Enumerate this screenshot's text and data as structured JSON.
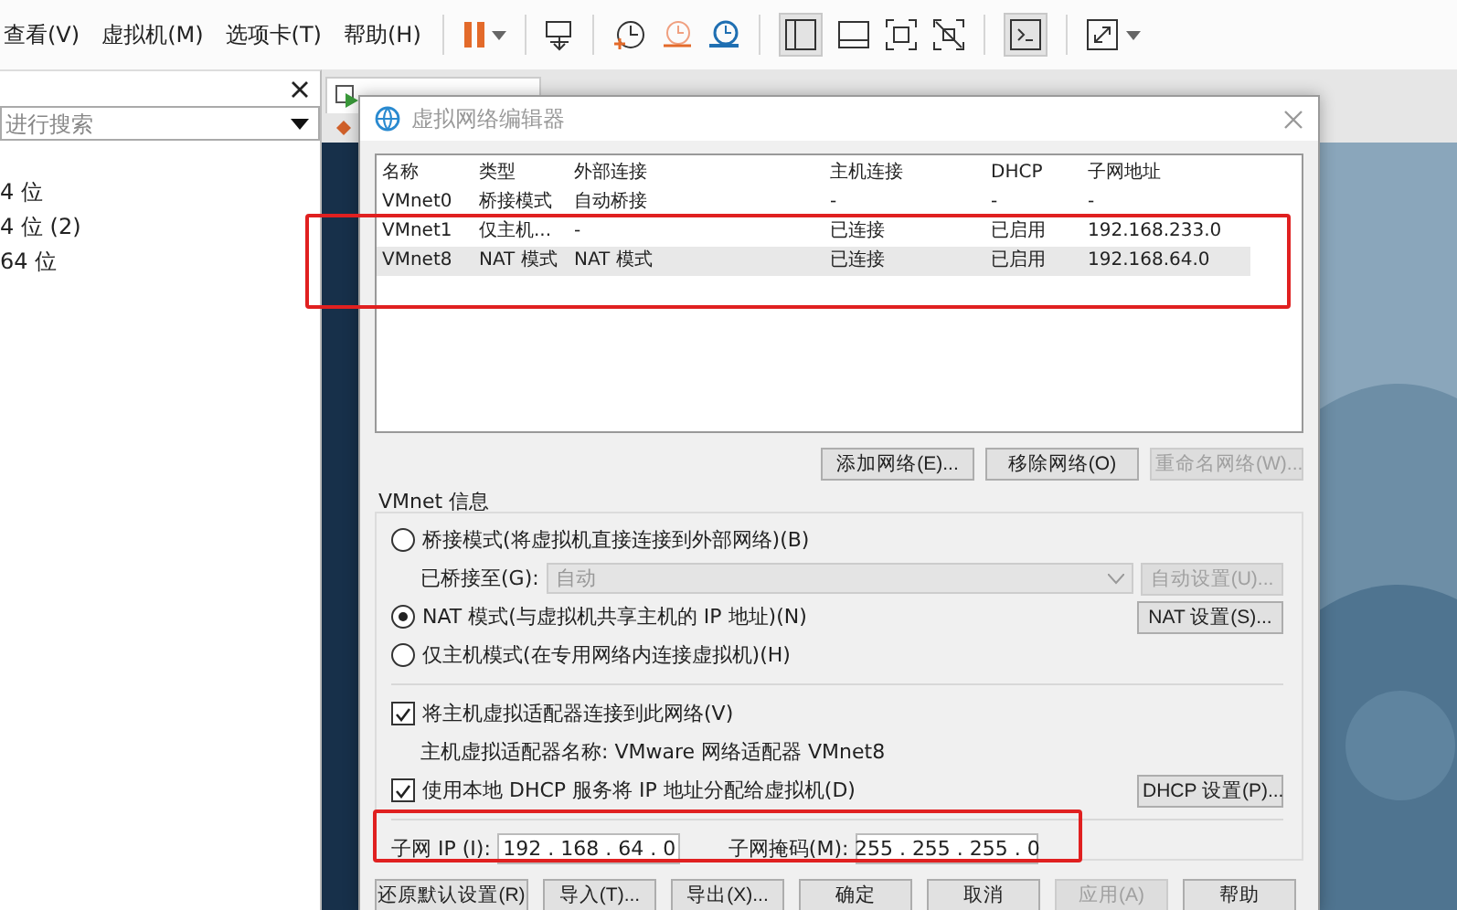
{
  "menu": [
    {
      "label": "查看(V)"
    },
    {
      "label": "虚拟机(M)"
    },
    {
      "label": "选项卡(T)"
    },
    {
      "label": "帮助(H)"
    }
  ],
  "sidebar": {
    "search": {
      "placeholder": "进行搜索"
    },
    "items": [
      "4 位",
      "4 位 (2)",
      "64 位"
    ]
  },
  "dialog": {
    "title": "虚拟网络编辑器",
    "networks": {
      "columns": [
        "名称",
        "类型",
        "外部连接",
        "主机连接",
        "DHCP",
        "子网地址"
      ],
      "rows": [
        {
          "cells": [
            "VMnet0",
            "桥接模式",
            "自动桥接",
            "-",
            "-",
            "-"
          ],
          "selected": false
        },
        {
          "cells": [
            "VMnet1",
            "仅主机...",
            "-",
            "已连接",
            "已启用",
            "192.168.233.0"
          ],
          "selected": false
        },
        {
          "cells": [
            "VMnet8",
            "NAT 模式",
            "NAT 模式",
            "已连接",
            "已启用",
            "192.168.64.0"
          ],
          "selected": true
        }
      ]
    },
    "network_buttons": [
      {
        "label": "添加网络(E)...",
        "disabled": false
      },
      {
        "label": "移除网络(O)",
        "disabled": false
      },
      {
        "label": "重命名网络(W)...",
        "disabled": true
      }
    ],
    "info": {
      "title": "VMnet 信息",
      "modes": [
        {
          "label": "桥接模式(将虚拟机直接连接到外部网络)(B)",
          "selected": false
        },
        {
          "label": "NAT 模式(与虚拟机共享主机的 IP 地址)(N)",
          "selected": true
        },
        {
          "label": "仅主机模式(在专用网络内连接虚拟机)(H)",
          "selected": false
        }
      ],
      "bridge_to": {
        "label": "已桥接至(G):",
        "value": "自动",
        "disabled": true
      },
      "auto_button": {
        "label": "自动设置(U)...",
        "disabled": true
      },
      "nat_button": {
        "label": "NAT 设置(S)...",
        "disabled": false
      },
      "host_adapter": {
        "label": "将主机虚拟适配器连接到此网络(V)",
        "checked": true
      },
      "adapter_name": "主机虚拟适配器名称: VMware 网络适配器 VMnet8",
      "dhcp": {
        "label": "使用本地 DHCP 服务将 IP 地址分配给虚拟机(D)",
        "checked": true
      },
      "dhcp_button": {
        "label": "DHCP 设置(P)...",
        "disabled": false
      },
      "subnet_ip": {
        "label": "子网 IP (I):",
        "value": "192 . 168 . 64 . 0"
      },
      "subnet_mask": {
        "label": "子网掩码(M):",
        "value": "255 . 255 . 255 . 0"
      }
    },
    "footer_buttons": [
      {
        "label": "还原默认设置(R)",
        "disabled": false
      },
      {
        "label": "导入(T)...",
        "disabled": false
      },
      {
        "label": "导出(X)...",
        "disabled": false
      },
      {
        "label": "确定",
        "disabled": false
      },
      {
        "label": "取消",
        "disabled": false
      },
      {
        "label": "应用(A)",
        "disabled": true
      },
      {
        "label": "帮助",
        "disabled": false
      }
    ]
  }
}
